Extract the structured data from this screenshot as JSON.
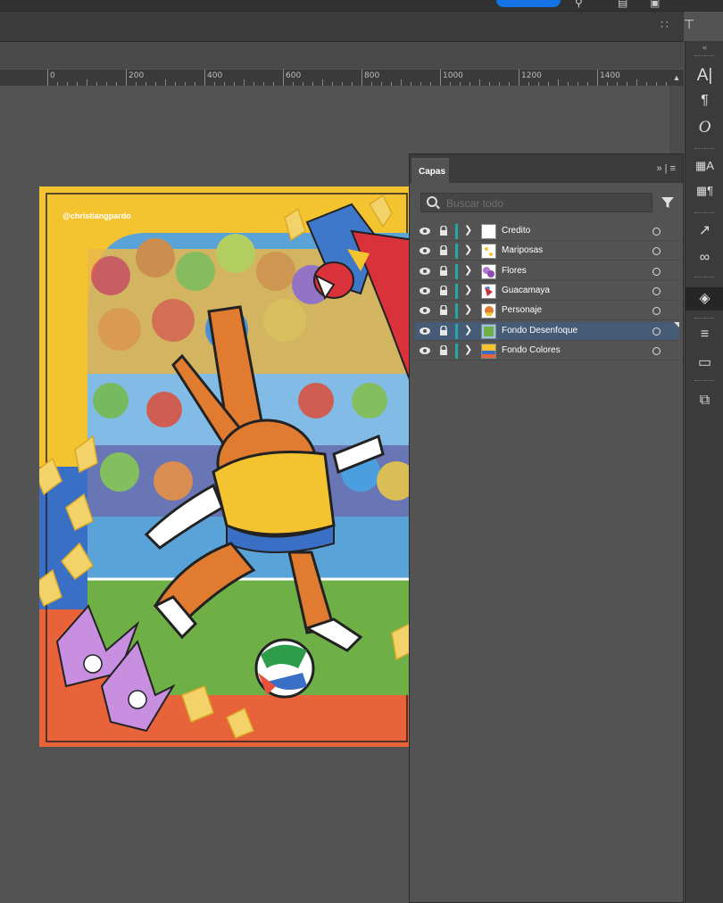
{
  "layers_panel": {
    "tab_label": "Capas",
    "search_placeholder": "Buscar todo",
    "layers": [
      {
        "name": "Credito",
        "selected": false,
        "thumb": "blank"
      },
      {
        "name": "Mariposas",
        "selected": false,
        "thumb": "butterflies"
      },
      {
        "name": "Flores",
        "selected": false,
        "thumb": "flowers"
      },
      {
        "name": "Guacamaya",
        "selected": false,
        "thumb": "parrot"
      },
      {
        "name": "Personaje",
        "selected": false,
        "thumb": "character"
      },
      {
        "name": "Fondo Desenfoque",
        "selected": true,
        "thumb": "blur-bg"
      },
      {
        "name": "Fondo Colores",
        "selected": false,
        "thumb": "flag-bg"
      }
    ],
    "layer_color": "#26a8a4",
    "selected_color": "#465b75"
  },
  "ruler": {
    "labels": [
      "0",
      "200",
      "400",
      "600",
      "800",
      "1000",
      "1200",
      "1400"
    ]
  },
  "artboard": {
    "credit_text": "@christiangpardo",
    "colors": {
      "yellow": "#f4c430",
      "blue": "#3a6fc6",
      "red": "#e8623a",
      "green": "#5fa83a"
    }
  },
  "toolstrip": {
    "icons": [
      "character-icon",
      "paragraph-icon",
      "opentype-icon",
      "character-styles-icon",
      "paragraph-styles-icon",
      "export-icon",
      "links-icon",
      "layers-icon",
      "stroke-icon",
      "gradient-icon",
      "transparency-icon"
    ]
  }
}
